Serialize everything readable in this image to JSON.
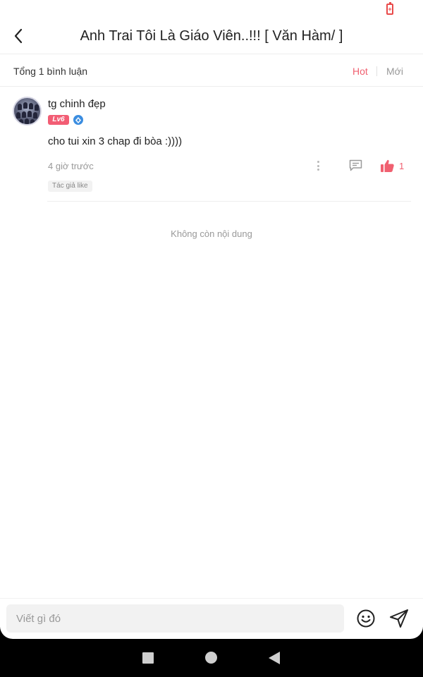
{
  "status_bar": {
    "battery_icon": "battery-charging-icon",
    "battery_color": "#e94a4a"
  },
  "header": {
    "back_icon": "chevron-left-icon",
    "title": "Anh Trai Tôi Là Giáo Viên..!!! [ Văn Hàm/ ]"
  },
  "summary": {
    "total_label": "Tổng 1 bình luận",
    "sort_options": [
      "Hot",
      "Mới"
    ],
    "active_sort": "Hot",
    "accent_color": "#f06070"
  },
  "comments": [
    {
      "username": "tg chinh đẹp",
      "level": "Lv6",
      "badge_icon": "gem-icon",
      "text": "cho tui xin 3 chap đi bòa :))))",
      "time": "4 giờ trước",
      "likes": "1",
      "tag": "Tác giả like"
    }
  ],
  "end_message": "Không còn nội dung",
  "composer": {
    "placeholder": "Viết gì đó",
    "emoji_icon": "smiley-icon",
    "send_icon": "send-icon"
  },
  "system_nav": [
    "recents-icon",
    "home-icon",
    "back-icon"
  ]
}
